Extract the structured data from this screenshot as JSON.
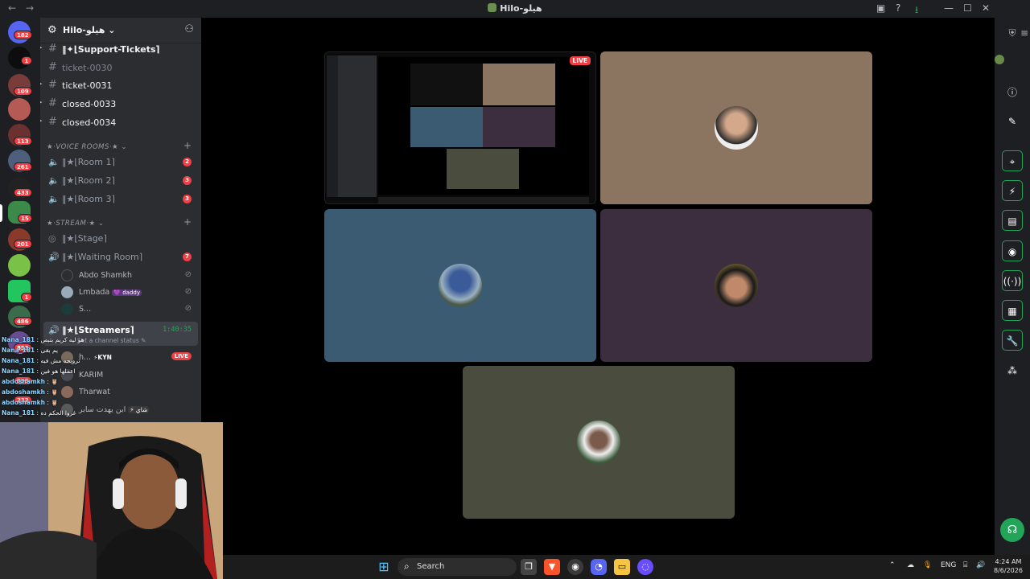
{
  "window": {
    "title": "Hilo-هيلو",
    "back_icon": "arrow-left-icon",
    "forward_icon": "arrow-right-icon"
  },
  "server_rail": {
    "badges": [
      "182",
      "1",
      "109",
      "113",
      "261",
      "433",
      "15",
      "201",
      "1",
      "486",
      "853",
      "999",
      "232"
    ]
  },
  "server": {
    "name": "Hilo-هيلو"
  },
  "text_channels": [
    {
      "name": "‖✦⌊Support-Tickets⌉",
      "bold": true
    },
    {
      "name": "ticket-0030",
      "bold": false
    },
    {
      "name": "ticket-0031",
      "bold": true
    },
    {
      "name": "closed-0033",
      "bold": true
    },
    {
      "name": "closed-0034",
      "bold": true
    }
  ],
  "voice_category": "★·VOICE ROOMS·★",
  "voice_rooms": [
    {
      "name": "‖★⌊Room 1⌉",
      "count": "2"
    },
    {
      "name": "‖★⌊Room 2⌉",
      "count": "3"
    },
    {
      "name": "‖★⌊Room 3⌉",
      "count": "3"
    }
  ],
  "stream_category": "★·STREAM·★",
  "stage": {
    "name": "‖★⌊Stage⌉"
  },
  "waiting_room": {
    "name": "‖★⌊Waiting Room⌉",
    "count": "7",
    "users": [
      {
        "name": "Abdo Shamkh",
        "tag": ""
      },
      {
        "name": "Lmbada",
        "tag": "💜 daddy"
      },
      {
        "name": "S...",
        "tag": ""
      }
    ]
  },
  "streamers": {
    "name": "‖★⌊Streamers⌉",
    "timer": "1:40:35",
    "status_placeholder": "Set a channel status",
    "live_label": "LIVE",
    "users": [
      {
        "name": "h...",
        "tag": "⚡KYN"
      },
      {
        "name": "KARIM",
        "tag": ""
      },
      {
        "name": "Tharwat",
        "tag": ""
      },
      {
        "name": "ابن يهدت سابر",
        "tag": "شاي ⚡"
      }
    ]
  },
  "chat_overlay": [
    {
      "user": "Nana_181",
      "text": "هو ليه كريم بتبص"
    },
    {
      "user": "Nana_181",
      "text": "يم بقى"
    },
    {
      "user": "Nana_181",
      "text": "ترويحه مش فيه"
    },
    {
      "user": "Nana_181",
      "text": "اعملها هو فين"
    },
    {
      "user": "abdoshamkh",
      "text": "🦉"
    },
    {
      "user": "abdoshamkh",
      "text": "🦉"
    },
    {
      "user": "abdoshamkh",
      "text": "🦉"
    },
    {
      "user": "Nana_181",
      "text": "غروا الحكم ده"
    }
  ],
  "stage_view": {
    "live_label": "LIVE"
  },
  "colors": {
    "tile_screen": "#000000",
    "tile_tan": "#8b7561",
    "tile_blue": "#3b5b72",
    "tile_purple": "#3c2e3e",
    "tile_olive": "#4a4c3e",
    "live_red": "#f23f43",
    "online_green": "#23a559"
  },
  "right_rail": {
    "icons": [
      "shield-icon",
      "menu-icon",
      "info-icon",
      "pencil-icon",
      "focus-icon",
      "bolt-icon",
      "clipboard-icon",
      "chat-icon",
      "broadcast-icon",
      "layout-icon",
      "wrench-icon",
      "apps-icon",
      "support-icon"
    ]
  },
  "taskbar": {
    "search_label": "Search",
    "lang": "ENG",
    "time": "4:24 AM",
    "date": "8/6/2026"
  }
}
